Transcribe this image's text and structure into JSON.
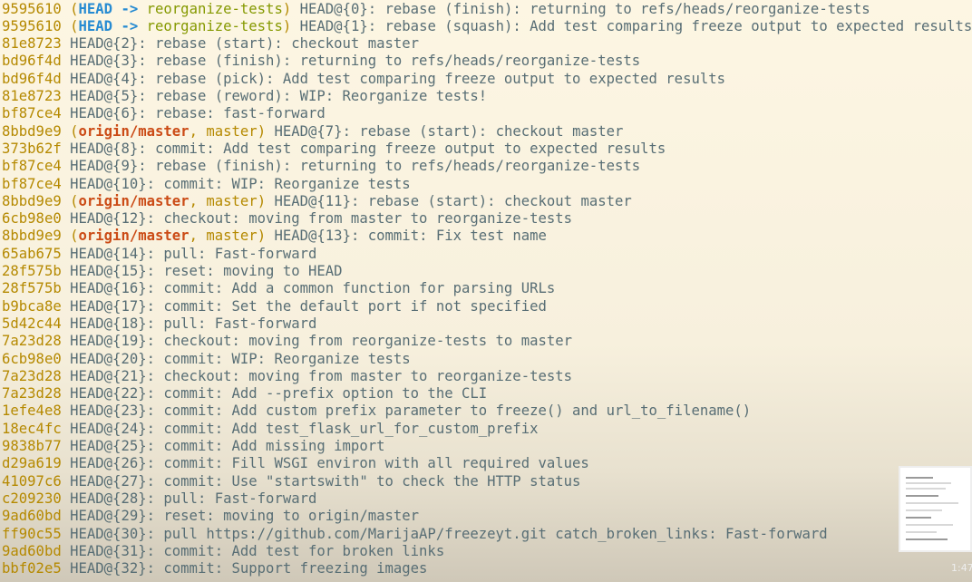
{
  "lines": [
    {
      "hash": "9595610",
      "decor": {
        "head": "HEAD",
        "arrow": "->",
        "branch": "reorganize-tests"
      },
      "ref": "HEAD@{0}:",
      "msg": "rebase (finish): returning to refs/heads/reorganize-tests"
    },
    {
      "hash": "9595610",
      "decor": {
        "head": "HEAD",
        "arrow": "->",
        "branch": "reorganize-tests"
      },
      "ref": "HEAD@{1}:",
      "msg": "rebase (squash): Add test comparing freeze output to expected results"
    },
    {
      "hash": "81e8723",
      "ref": "HEAD@{2}:",
      "msg": "rebase (start): checkout master"
    },
    {
      "hash": "bd96f4d",
      "ref": "HEAD@{3}:",
      "msg": "rebase (finish): returning to refs/heads/reorganize-tests"
    },
    {
      "hash": "bd96f4d",
      "ref": "HEAD@{4}:",
      "msg": "rebase (pick): Add test comparing freeze output to expected results"
    },
    {
      "hash": "81e8723",
      "ref": "HEAD@{5}:",
      "msg": "rebase (reword): WIP: Reorganize tests!"
    },
    {
      "hash": "bf87ce4",
      "ref": "HEAD@{6}:",
      "msg": "rebase: fast-forward"
    },
    {
      "hash": "8bbd9e9",
      "decor": {
        "origin": "origin/master",
        "local": "master"
      },
      "ref": "HEAD@{7}:",
      "msg": "rebase (start): checkout master"
    },
    {
      "hash": "373b62f",
      "ref": "HEAD@{8}:",
      "msg": "commit: Add test comparing freeze output to expected results"
    },
    {
      "hash": "bf87ce4",
      "ref": "HEAD@{9}:",
      "msg": "rebase (finish): returning to refs/heads/reorganize-tests"
    },
    {
      "hash": "bf87ce4",
      "ref": "HEAD@{10}:",
      "msg": "commit: WIP: Reorganize tests"
    },
    {
      "hash": "8bbd9e9",
      "decor": {
        "origin": "origin/master",
        "local": "master"
      },
      "ref": "HEAD@{11}:",
      "msg": "rebase (start): checkout master"
    },
    {
      "hash": "6cb98e0",
      "ref": "HEAD@{12}:",
      "msg": "checkout: moving from master to reorganize-tests"
    },
    {
      "hash": "8bbd9e9",
      "decor": {
        "origin": "origin/master",
        "local": "master"
      },
      "ref": "HEAD@{13}:",
      "msg": "commit: Fix test name"
    },
    {
      "hash": "65ab675",
      "ref": "HEAD@{14}:",
      "msg": "pull: Fast-forward"
    },
    {
      "hash": "28f575b",
      "ref": "HEAD@{15}:",
      "msg": "reset: moving to HEAD"
    },
    {
      "hash": "28f575b",
      "ref": "HEAD@{16}:",
      "msg": "commit: Add a common function for parsing URLs"
    },
    {
      "hash": "b9bca8e",
      "ref": "HEAD@{17}:",
      "msg": "commit: Set the default port if not specified"
    },
    {
      "hash": "5d42c44",
      "ref": "HEAD@{18}:",
      "msg": "pull: Fast-forward"
    },
    {
      "hash": "7a23d28",
      "ref": "HEAD@{19}:",
      "msg": "checkout: moving from reorganize-tests to master"
    },
    {
      "hash": "6cb98e0",
      "ref": "HEAD@{20}:",
      "msg": "commit: WIP: Reorganize tests"
    },
    {
      "hash": "7a23d28",
      "ref": "HEAD@{21}:",
      "msg": "checkout: moving from master to reorganize-tests"
    },
    {
      "hash": "7a23d28",
      "ref": "HEAD@{22}:",
      "msg": "commit: Add --prefix option to the CLI"
    },
    {
      "hash": "1efe4e8",
      "ref": "HEAD@{23}:",
      "msg": "commit: Add custom prefix parameter to freeze() and url_to_filename()"
    },
    {
      "hash": "18ec4fc",
      "ref": "HEAD@{24}:",
      "msg": "commit: Add test_flask_url_for_custom_prefix"
    },
    {
      "hash": "9838b77",
      "ref": "HEAD@{25}:",
      "msg": "commit: Add missing import"
    },
    {
      "hash": "d29a619",
      "ref": "HEAD@{26}:",
      "msg": "commit: Fill WSGI environ with all required values"
    },
    {
      "hash": "41097c6",
      "ref": "HEAD@{27}:",
      "msg": "commit: Use \"startswith\" to check the HTTP status"
    },
    {
      "hash": "c209230",
      "ref": "HEAD@{28}:",
      "msg": "pull: Fast-forward"
    },
    {
      "hash": "9ad60bd",
      "ref": "HEAD@{29}:",
      "msg": "reset: moving to origin/master"
    },
    {
      "hash": "ff90c55",
      "ref": "HEAD@{30}:",
      "msg": "pull https://github.com/MarijaAP/freezeyt.git catch_broken_links: Fast-forward"
    },
    {
      "hash": "9ad60bd",
      "ref": "HEAD@{31}:",
      "msg": "commit: Add test for broken links"
    },
    {
      "hash": "bbf02e5",
      "ref": "HEAD@{32}:",
      "msg": "commit: Support freezing images"
    }
  ],
  "video": {
    "timestamp": "1:47"
  },
  "colors": {
    "background": "#fdf6e3",
    "hash": "#b58900",
    "head": "#268bd2",
    "branch": "#859900",
    "origin": "#cb4b16",
    "text": "#586e75"
  }
}
